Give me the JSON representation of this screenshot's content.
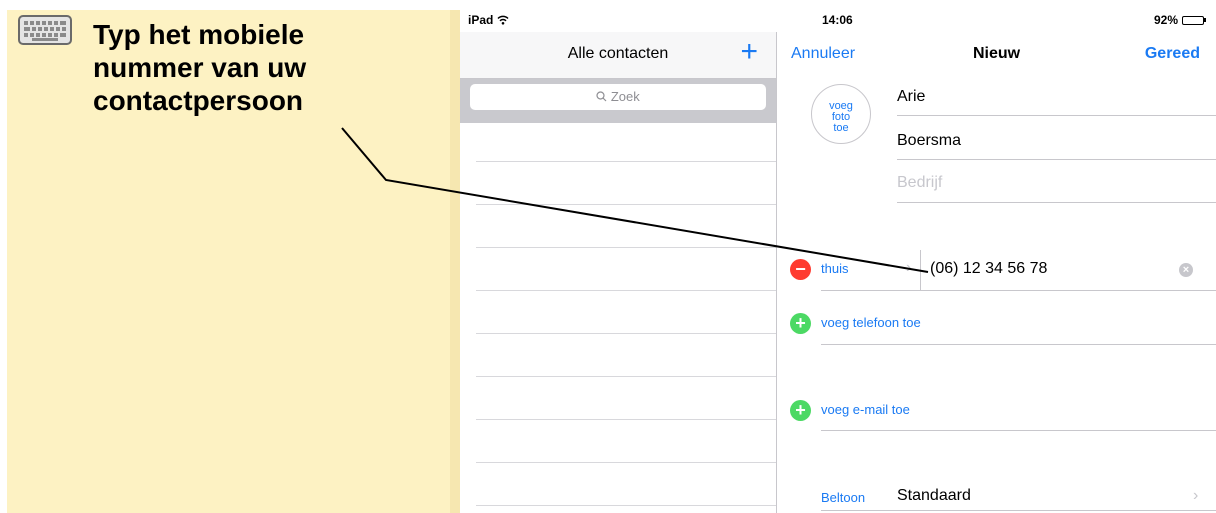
{
  "instruction": {
    "icon": "keyboard-icon",
    "lines": [
      "Typ het mobiele",
      "nummer van uw",
      "contactpersoon"
    ]
  },
  "status_bar": {
    "carrier": "iPad",
    "time": "14:06",
    "battery": "92%",
    "battery_level": 0.92
  },
  "contacts_pane": {
    "title": "Alle contacten",
    "add_label": "+",
    "search_placeholder": "Zoek"
  },
  "new_contact": {
    "cancel_label": "Annuleer",
    "title": "Nieuw",
    "done_label": "Gereed",
    "photo_label": [
      "voeg",
      "foto",
      "toe"
    ],
    "first_name": "Arie",
    "last_name": "Boersma",
    "company_placeholder": "Bedrijf",
    "phone": {
      "remove_icon": "minus-circle-icon",
      "label": "thuis",
      "value": "(06) 12 34 56 78",
      "clear_icon": "clear-icon"
    },
    "add_phone_label": "voeg telefoon toe",
    "add_email_label": "voeg e-mail toe",
    "ringtone_label": "Beltoon",
    "ringtone_value": "Standaard"
  },
  "colors": {
    "accent": "#1a7af3",
    "instruction_bg": "#fdf2c3",
    "remove": "#ff3b30",
    "add": "#4cd964"
  }
}
